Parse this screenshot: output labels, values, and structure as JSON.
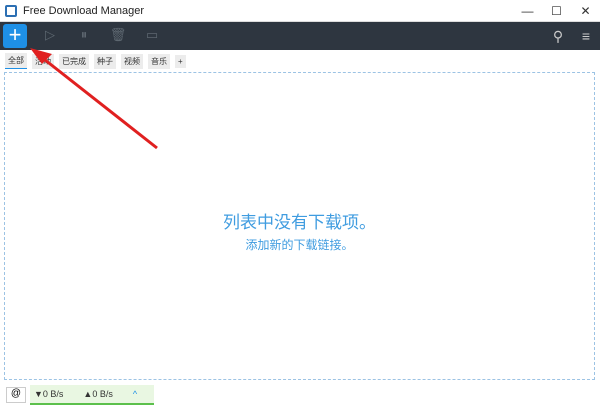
{
  "window": {
    "title": "Free Download Manager",
    "minimize": "—",
    "maximize": "☐",
    "close": "✕"
  },
  "toolbar": {
    "add": "+",
    "start": "▷",
    "pause": "⏸",
    "delete": "🗑",
    "move": "▭",
    "search": "⚲",
    "menu": "≡"
  },
  "tabs": [
    {
      "label": "全部"
    },
    {
      "label": "活动"
    },
    {
      "label": "已完成"
    },
    {
      "label": "种子"
    },
    {
      "label": "视频"
    },
    {
      "label": "音乐"
    }
  ],
  "add_tab": "+",
  "empty": {
    "title": "列表中没有下载项。",
    "subtitle": "添加新的下载链接。"
  },
  "status": {
    "snail": "@",
    "down": "▼0 B/s",
    "up": "▲0 B/s",
    "expand": "^"
  },
  "colors": {
    "accent": "#1e90e6",
    "toolbar": "#2e3640",
    "arrow": "#e02020"
  }
}
